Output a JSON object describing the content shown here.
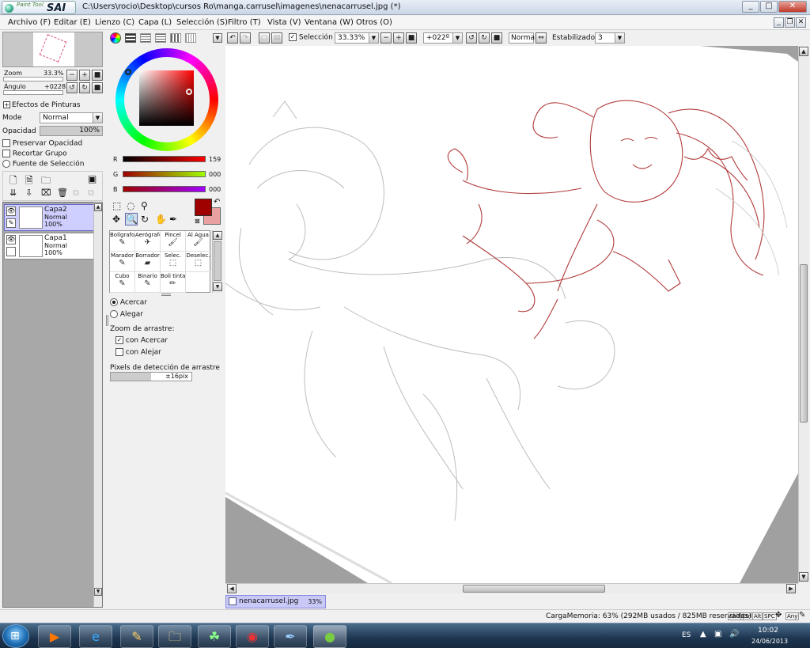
{
  "window": {
    "app_name": "SAI",
    "app_sub": "Paint Tool",
    "title": "C:\\Users\\rocio\\Desktop\\cursos Ro\\manga.carrusel\\imagenes\\nenacarrusel.jpg (*)",
    "min": "_",
    "max": "□",
    "close": "✕"
  },
  "menu": [
    "Archivo (F)",
    "Editar (E)",
    "Lienzo (C)",
    "Capa (L)",
    "Selección (S)",
    "Filtro (T)",
    "Vista (V)",
    "Ventana (W)",
    "Otros (O)"
  ],
  "navigator": {
    "zoom_label": "Zoom",
    "zoom_value": "33.3%",
    "angle_label": "Ángulo",
    "angle_value": "+0228"
  },
  "layer_props": {
    "effects_label": "Efectos de Pinturas",
    "mode_label": "Mode",
    "mode_value": "Normal",
    "opacity_label": "Opacidad",
    "opacity_value": "100%",
    "preserve": "Preservar Opacidad",
    "clip": "Recortar Grupo",
    "selection_source": "Fuente de Selección"
  },
  "layers": [
    {
      "name": "Capa2",
      "mode": "Normal",
      "opacity": "100%",
      "selected": true
    },
    {
      "name": "Capa1",
      "mode": "Normal",
      "opacity": "100%",
      "selected": false
    }
  ],
  "color": {
    "r_label": "R",
    "r_value": "159",
    "g_label": "G",
    "g_value": "000",
    "b_label": "B",
    "b_value": "000",
    "primary": "#9f0000",
    "secondary": "#e8a0a0"
  },
  "tools": [
    {
      "label": "Bolígrafo",
      "icon": "pen-icon"
    },
    {
      "label": "Aerógrafo",
      "icon": "airbrush-icon"
    },
    {
      "label": "Pincel",
      "icon": "brush-icon"
    },
    {
      "label": "Al Agua",
      "icon": "watercolor-icon"
    },
    {
      "label": "Marador",
      "icon": "marker-icon"
    },
    {
      "label": "Borrador",
      "icon": "eraser-icon"
    },
    {
      "label": "Selec.",
      "icon": "select-pen-icon"
    },
    {
      "label": "Deselec.",
      "icon": "deselect-pen-icon"
    },
    {
      "label": "Cubo",
      "icon": "bucket-icon"
    },
    {
      "label": "Binario",
      "icon": "binary-pen-icon"
    },
    {
      "label": "Boli tinta",
      "icon": "ink-pen-icon"
    }
  ],
  "zoom_tool": {
    "zoom_in": "Acercar",
    "zoom_out": "Alegar",
    "drag_label": "Zoom de arrastre:",
    "with_in": "con Acercar",
    "with_out": "con Alejar",
    "pixels_label": "Pixels de detección de arrastre",
    "pixels_value": "±16pix"
  },
  "canvas_toolbar": {
    "selection": "Selección",
    "zoom": "33.33%",
    "angle": "+022º",
    "blend": "Normal",
    "stabilizer_label": "Estabilizador",
    "stabilizer_value": "3"
  },
  "file_tab": {
    "name": "nenacarrusel.jpg",
    "zoom": "33%"
  },
  "status": {
    "memory": "CargaMemoria: 63% (292MB usados / 825MB reservados)",
    "keys": [
      "Shift",
      "Ctrl",
      "Alt",
      "SPC"
    ],
    "any": "Any"
  },
  "taskbar": {
    "lang": "ES",
    "time": "10:02",
    "date": "24/06/2013",
    "apps": [
      "media-player-icon",
      "internet-explorer-icon",
      "paint-app-icon",
      "file-explorer-icon",
      "network-app-icon",
      "chrome-icon",
      "ink-app-icon",
      "paint-tool-sai-icon"
    ]
  }
}
